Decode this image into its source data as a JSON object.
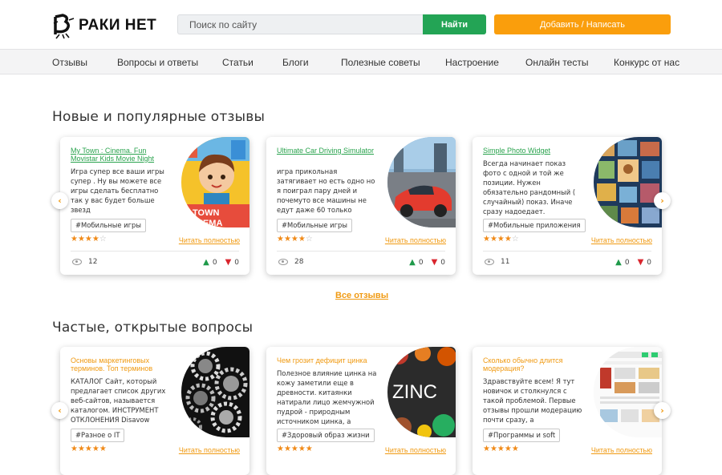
{
  "header": {
    "logo_text": "РАКИ НЕТ",
    "logo_letter": "В",
    "search_placeholder": "Поиск по сайту",
    "search_button": "Найти",
    "add_button": "Добавить / Написать"
  },
  "nav": [
    "Отзывы",
    "Вопросы и ответы",
    "Статьи",
    "Блоги",
    "Полезные советы",
    "Настроение",
    "Онлайн тесты",
    "Конкурс от нас"
  ],
  "reviews_section": {
    "title": "Новые и популярные отзывы",
    "all_link": "Все отзывы",
    "cards": [
      {
        "title": "My Town : Cinema. Fun Movistar Kids Movie Night",
        "desc": "Игра супер все ваши игры супер . Ну вы можете все игры сделать бесплатно так у вас будет больше звезд",
        "tag": "#Мобильные игры",
        "rating": 4,
        "more": "Читать полностью",
        "views": "12",
        "likes": "0",
        "dislikes": "0",
        "image": "game-town-image"
      },
      {
        "title": "Ultimate Car Driving Simulator",
        "desc": "игра прикольная затягивает но есть одно но я поиграл пару дней и почемуто все машины не едут даже 60 только",
        "tag": "#Мобильные игры",
        "rating": 4,
        "more": "Читать полностью",
        "views": "28",
        "likes": "0",
        "dislikes": "0",
        "image": "race-car-image"
      },
      {
        "title": "Simple Photo Widget",
        "desc": "Всегда начинает показ фото с одной и той же позиции. Нужен обязательно рандомный ( случайный) показ. Иначе сразу надоедает.",
        "tag": "#Мобильные приложения",
        "rating": 4,
        "more": "Читать полностью",
        "views": "11",
        "likes": "0",
        "dislikes": "0",
        "image": "photo-widget-image"
      }
    ]
  },
  "questions_section": {
    "title": "Частые, открытые вопросы",
    "cards": [
      {
        "title": "Основы маркетинговых терминов. Топ терминов",
        "desc": "КАТАЛОГ Сайт, который предлагает список других веб-сайтов, называется каталогом. ИНСТРУМЕНТ ОТКЛОНЕНИЯ Disavow",
        "tag": "#Разное о IT",
        "rating": 5,
        "more": "Читать полностью",
        "image": "gears-image"
      },
      {
        "title": "Чем грозит дефицит цинка",
        "desc": "Полезное влияние цинка на кожу заметили еще в древности. китаянки натирали лицо жемчужной пудрой - природным источником цинка, а",
        "tag": "#Здоровый образ жизни",
        "rating": 5,
        "more": "Читать полностью",
        "image": "zinc-food-image",
        "image_text": "ZINC"
      },
      {
        "title": "Сколько обычно длится модерация?",
        "desc": "Здравствуйте всем! Я тут новичок и столкнулся с такой проблемой. Первые отзывы прошли модерацию почти сразу, а",
        "tag": "#Программы и soft",
        "rating": 5,
        "more": "Читать полностью",
        "image": "website-screenshot-image"
      }
    ]
  },
  "colors": {
    "green": "#23a455",
    "orange": "#fa9e0c",
    "link_green": "#2aa34e",
    "link_orange": "#f09a12"
  }
}
